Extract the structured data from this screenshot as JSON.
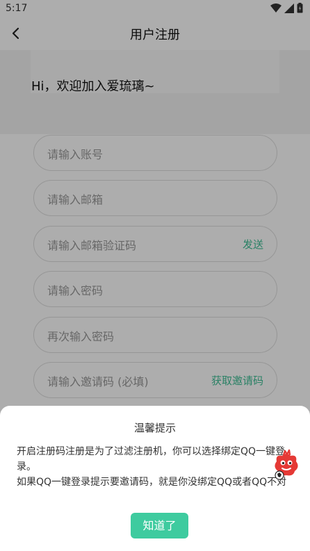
{
  "status_bar": {
    "time": "5:17"
  },
  "header": {
    "title": "用户注册"
  },
  "banner": {
    "greeting": "Hi，欢迎加入爱琉璃~"
  },
  "form": {
    "account_placeholder": "请输入账号",
    "email_placeholder": "请输入邮箱",
    "email_code_placeholder": "请输入邮箱验证码",
    "send_label": "发送",
    "password_placeholder": "请输入密码",
    "confirm_password_placeholder": "再次输入密码",
    "invite_placeholder": "请输入邀请码 (必填)",
    "get_invite_label": "获取邀请码"
  },
  "dialog": {
    "title": "温馨提示",
    "line1": "开启注册码注册是为了过滤注册机，你可以选择绑定QQ一键登录。",
    "line2": "如果QQ一键登录提示要邀请码，就是你没绑定QQ或者QQ不对",
    "confirm_label": "知道了"
  },
  "colors": {
    "accent": "#3ecb9f",
    "link": "#3fbf96"
  },
  "icons": [
    "back-icon",
    "wifi-icon",
    "signal-icon",
    "battery-icon",
    "mascot-icon"
  ]
}
